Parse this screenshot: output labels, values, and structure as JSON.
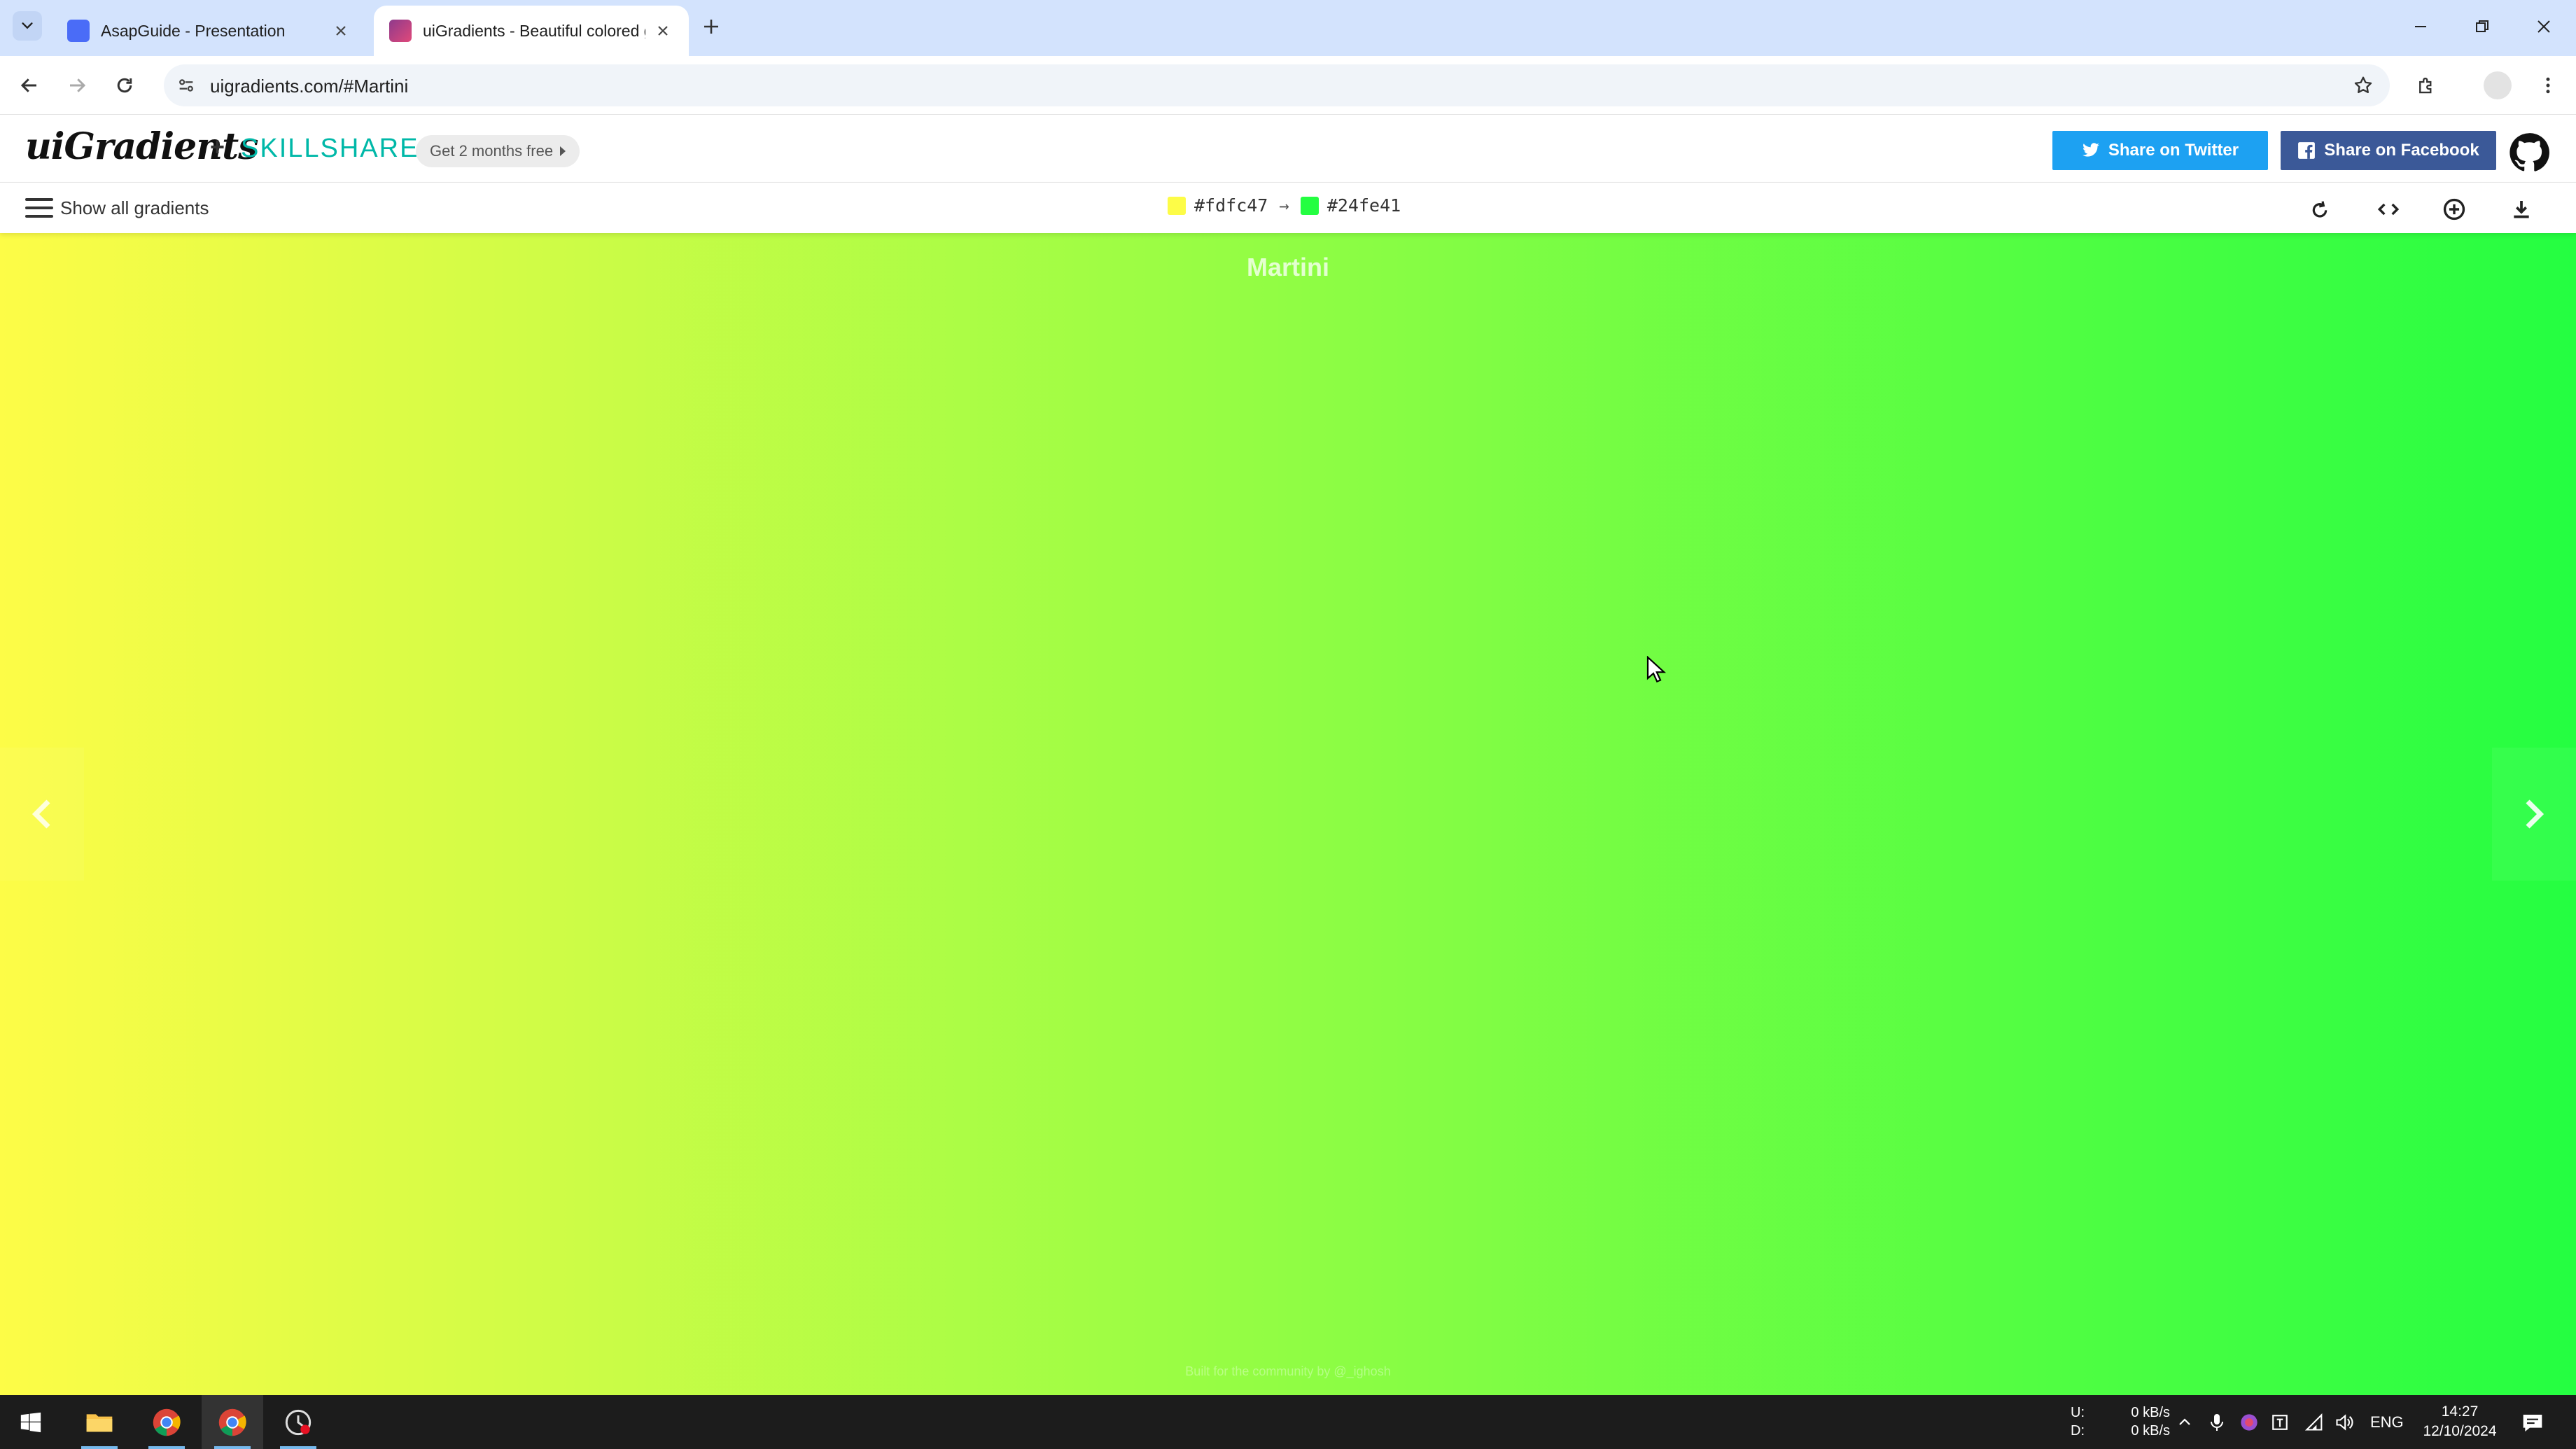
{
  "browser": {
    "tabs": [
      {
        "title": "AsapGuide - Presentation",
        "favicon_color": "#4a6cf7",
        "active": false
      },
      {
        "title": "uiGradients - Beautiful colored gradients",
        "favicon_color": "#c0437b",
        "active": true
      }
    ],
    "url": "uigradients.com/#Martini"
  },
  "header": {
    "logo": "uiGradients",
    "plus": "+",
    "partner": "SKILLSHARE",
    "promo": "Get 2 months free",
    "share_twitter": "Share on Twitter",
    "share_facebook": "Share on Facebook"
  },
  "subbar": {
    "show_all": "Show all gradients",
    "color_from": "#fdfc47",
    "color_to": "#24fe41",
    "arrow": "→"
  },
  "gradient": {
    "name": "Martini",
    "from": "#fdfc47",
    "to": "#24fe41",
    "credit": "Built for the community by @_ighosh"
  },
  "taskbar": {
    "net_up_label": "U:",
    "net_down_label": "D:",
    "net_up": "0 kB/s",
    "net_down": "0 kB/s",
    "lang": "ENG",
    "time": "14:27",
    "date": "12/10/2024"
  }
}
